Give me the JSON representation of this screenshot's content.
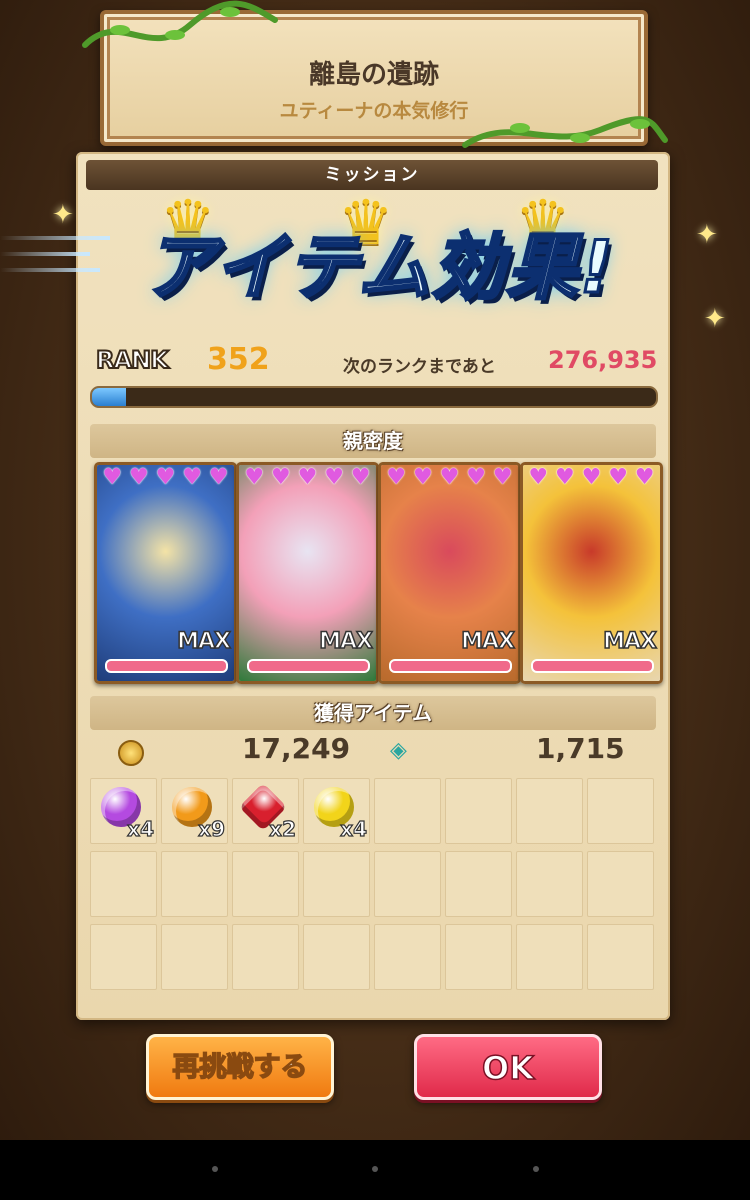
{
  "stage": {
    "title": "離島の遺跡",
    "subtitle": "ユティーナの本気修行"
  },
  "mission": {
    "header": "ミッション"
  },
  "banner": {
    "text": "アイテム効果!"
  },
  "rank": {
    "label": "RANK",
    "value": "352",
    "next_label": "次のランクまであと",
    "next_value": "276,935",
    "progress": 0.06
  },
  "affinity": {
    "header": "親密度",
    "characters": [
      {
        "hearts": 5,
        "max_label": "MAX",
        "art_colors": [
          "#1f3d7a",
          "#3f6fc4",
          "#f4e3a6"
        ]
      },
      {
        "hearts": 5,
        "max_label": "MAX",
        "art_colors": [
          "#2f7a3a",
          "#f3a0b8",
          "#e8e4f2"
        ]
      },
      {
        "hearts": 5,
        "max_label": "MAX",
        "art_colors": [
          "#b86a2c",
          "#e6824a",
          "#d94a5c"
        ]
      },
      {
        "hearts": 5,
        "max_label": "MAX",
        "art_colors": [
          "#e8d6b0",
          "#f4c23a",
          "#c83a2a"
        ]
      }
    ]
  },
  "rewards": {
    "header": "獲得アイテム",
    "coins": "17,249",
    "gems": "1,715",
    "items": [
      {
        "color": "#b44ae0",
        "shape": "round",
        "count": "x4"
      },
      {
        "color": "#f29a1a",
        "shape": "round",
        "count": "x9"
      },
      {
        "color": "#d8202e",
        "shape": "hex",
        "count": "x2"
      },
      {
        "color": "#f2d41a",
        "shape": "round",
        "count": "x4"
      }
    ],
    "slots": 24
  },
  "buttons": {
    "retry": "再挑戦する",
    "ok": "OK"
  }
}
